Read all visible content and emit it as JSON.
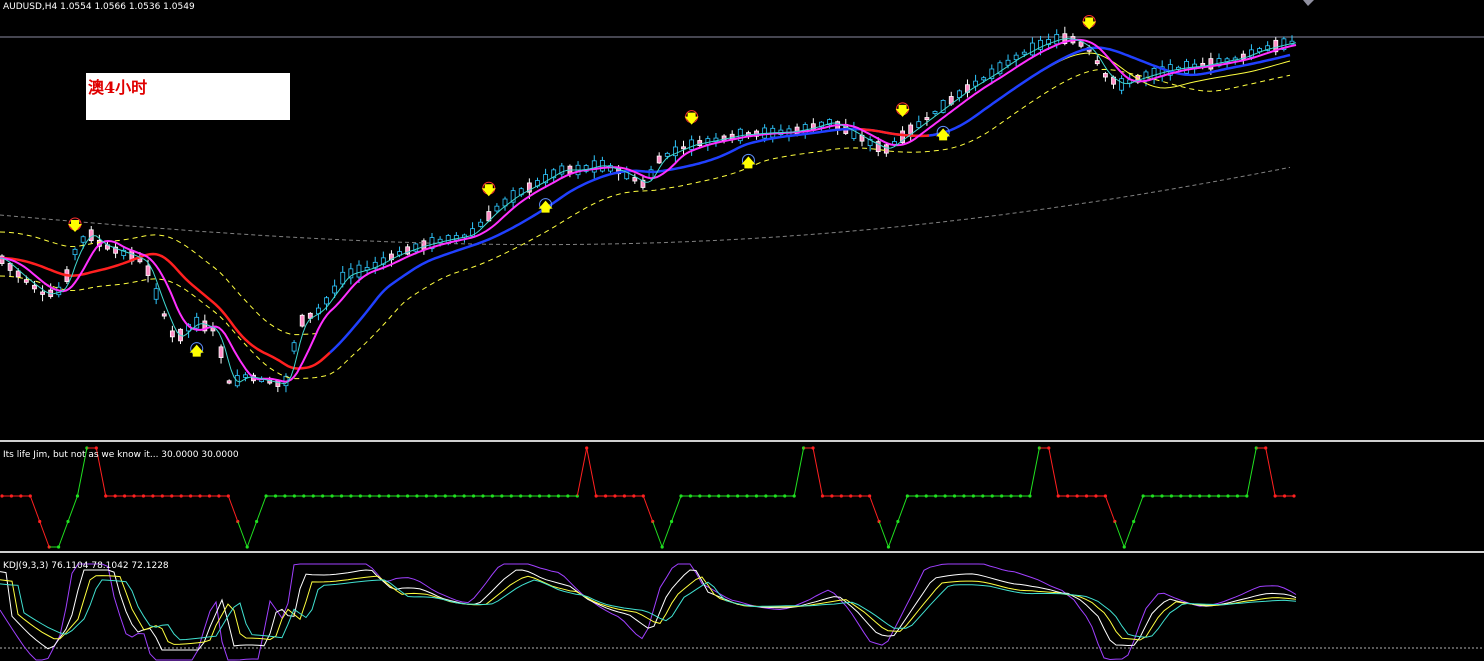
{
  "title": "AUDUSD,H4  1.0554 1.0566 1.0536 1.0549",
  "note": "澳4小时",
  "colors": {
    "background": "#000000",
    "bull_candle": "#2fc8ff",
    "bear_candle": "#ffffff",
    "bear_body": "#ff8fc8",
    "ma_fast": "#ff30ff",
    "ma_slow": "#2040ff",
    "ma_slow_down": "#ff2020",
    "band": "#ffff40",
    "long_ma": "#808080",
    "signal_up": "#ffff00",
    "signal_down": "#ffff00",
    "osc_up": "#20e020",
    "osc_down": "#ff2020",
    "kdj_k": "#ffffff",
    "kdj_d": "#ffff40",
    "kdj_j": "#a040ff",
    "kdj_signal": "#40e0d0"
  },
  "panels": {
    "oscillator": {
      "label": "Its life Jim, but not as we know it...  30.0000 30.0000"
    },
    "kdj": {
      "label": "KDJ(9,3,3) 76.1104 78.1042 72.1228"
    }
  },
  "chart_data": [
    {
      "type": "candlestick",
      "symbol": "AUDUSD",
      "timeframe": "H4",
      "last_ohlc": {
        "open": 1.0554,
        "high": 1.0566,
        "low": 1.0536,
        "close": 1.0549
      },
      "price_range": [
        0.98,
        1.06
      ],
      "candles_count": 160,
      "signals": [
        {
          "type": "down",
          "x_index": 9
        },
        {
          "type": "up",
          "x_index": 24
        },
        {
          "type": "down",
          "x_index": 60
        },
        {
          "type": "up",
          "x_index": 67
        },
        {
          "type": "down",
          "x_index": 85
        },
        {
          "type": "up",
          "x_index": 92
        },
        {
          "type": "down",
          "x_index": 111
        },
        {
          "type": "up",
          "x_index": 116
        },
        {
          "type": "down",
          "x_index": 134
        }
      ]
    },
    {
      "type": "line",
      "title": "Its life Jim, but not as we know it...",
      "values": [
        30.0,
        30.0
      ],
      "level": "top-middle-bottom",
      "segments": [
        {
          "state": "down",
          "from": 0,
          "to": 5
        },
        {
          "state": "up",
          "from": 6,
          "to": 9
        },
        {
          "state": "down",
          "from": 10,
          "to": 26
        },
        {
          "state": "up",
          "from": 26,
          "to": 62
        },
        {
          "state": "down",
          "from": 62,
          "to": 70
        },
        {
          "state": "up",
          "from": 70,
          "to": 85
        },
        {
          "state": "down",
          "from": 86,
          "to": 94
        },
        {
          "state": "up",
          "from": 94,
          "to": 110
        },
        {
          "state": "down",
          "from": 111,
          "to": 119
        },
        {
          "state": "up",
          "from": 119,
          "to": 133
        },
        {
          "state": "down",
          "from": 134,
          "to": 137
        }
      ]
    },
    {
      "type": "line",
      "title": "KDJ(9,3,3)",
      "series": [
        {
          "name": "K",
          "last": 76.1104
        },
        {
          "name": "D",
          "last": 78.1042
        },
        {
          "name": "J",
          "last": 72.1228
        }
      ]
    }
  ]
}
